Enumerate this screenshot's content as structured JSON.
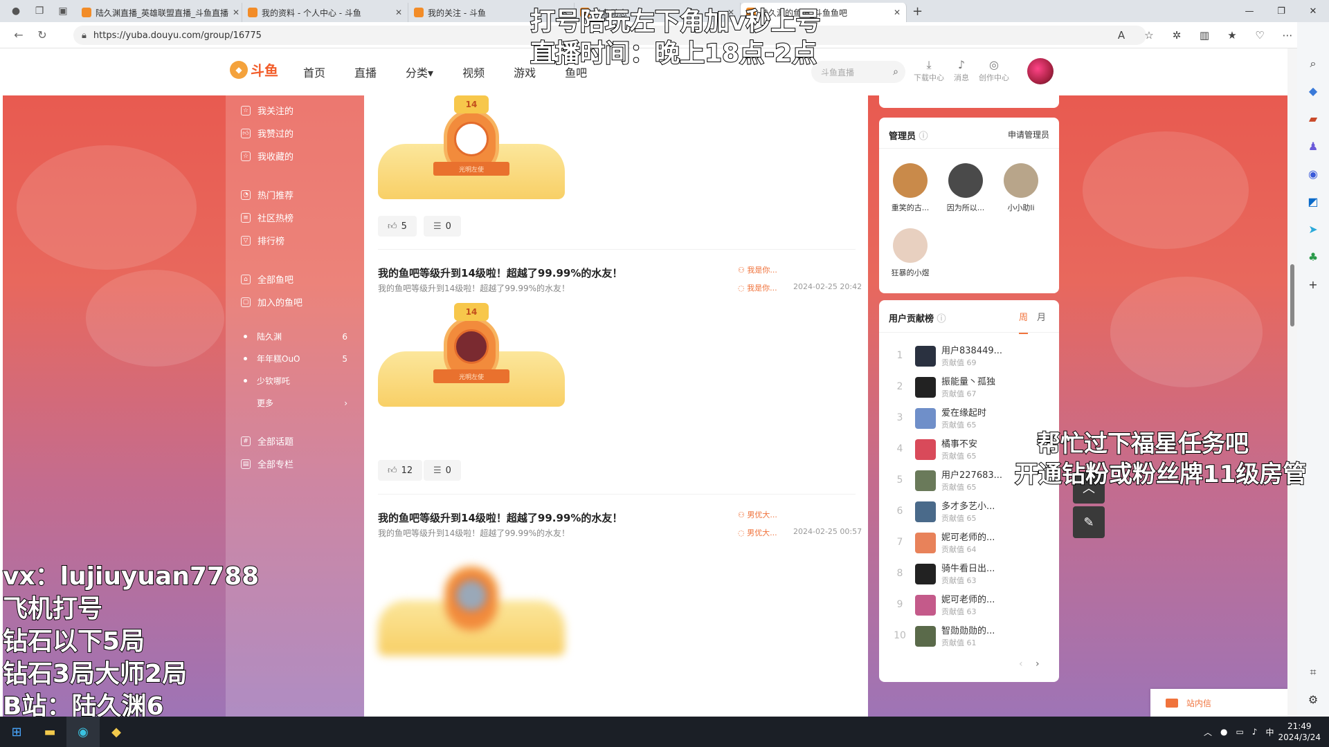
{
  "browser": {
    "tabs": [
      {
        "title": "陆久渊直播_英雄联盟直播_斗鱼直播"
      },
      {
        "title": "我的资料 - 个人中心 - 斗鱼"
      },
      {
        "title": "我的关注 - 斗鱼"
      },
      {
        "title": "斗鱼动态"
      },
      {
        "title": "陆久渊的鱼吧_斗鱼鱼吧"
      }
    ],
    "url": "https://yuba.douyu.com/group/16775"
  },
  "site": {
    "logo_text": "斗鱼",
    "nav": [
      "首页",
      "直播",
      "分类▾",
      "视频",
      "游戏",
      "鱼吧"
    ],
    "search_placeholder": "斗鱼直播",
    "header_icons": [
      {
        "icon": "download-icon",
        "label": "下载中心"
      },
      {
        "icon": "bell-icon",
        "label": "消息"
      },
      {
        "icon": "bulb-icon",
        "label": "创作中心"
      }
    ]
  },
  "sidebar": {
    "items": [
      {
        "icon": "star-icon",
        "label": "我关注的"
      },
      {
        "icon": "thumb-up-icon",
        "label": "我赞过的"
      },
      {
        "icon": "bookmark-icon",
        "label": "我收藏的"
      },
      {
        "icon": "fire-icon",
        "label": "热门推荐"
      },
      {
        "icon": "hot-list-icon",
        "label": "社区热榜"
      },
      {
        "icon": "trophy-icon",
        "label": "排行榜"
      },
      {
        "icon": "house-icon",
        "label": "全部鱼吧"
      },
      {
        "icon": "joined-icon",
        "label": "加入的鱼吧"
      }
    ],
    "groups": [
      {
        "name": "陆久渊",
        "count": "6"
      },
      {
        "name": "年年糕OuO",
        "count": "5"
      },
      {
        "name": "少钦哪吒",
        "count": ""
      }
    ],
    "more": "更多",
    "bottom": [
      {
        "icon": "hash-icon",
        "label": "全部话题"
      },
      {
        "icon": "column-icon",
        "label": "全部专栏"
      }
    ]
  },
  "feed": {
    "badge_number": "14",
    "badge_ribbon": "光明左使",
    "first_post": {
      "likes": "5",
      "comments": "0"
    },
    "posts": [
      {
        "title": "我的鱼吧等级升到14级啦！超越了99.99%的水友！",
        "subtitle": "我的鱼吧等级升到14级啦！超越了99.99%的水友！",
        "author": "我是你...",
        "author2": "我是你...",
        "date": "2024-02-25 20:42",
        "likes": "12",
        "comments": "0"
      },
      {
        "title": "我的鱼吧等级升到14级啦！超越了99.99%的水友！",
        "subtitle": "我的鱼吧等级升到14级啦！超越了99.99%的水友！",
        "author": "男优大...",
        "author2": "男优大...",
        "date": "2024-02-25 00:57"
      }
    ]
  },
  "admins": {
    "title": "管理员",
    "apply": "申请管理员",
    "list": [
      {
        "name": "重笑的古...",
        "color": "#c98a4a"
      },
      {
        "name": "因为所以...",
        "color": "#4a4a4a"
      },
      {
        "name": "小小助li",
        "color": "#b8a58a"
      },
      {
        "name": "狂暴的小煜",
        "color": "#e8d0c0"
      }
    ]
  },
  "contrib": {
    "title": "用户贡献榜",
    "tab_week": "周",
    "tab_month": "月",
    "score_label": "贡献值",
    "rows": [
      {
        "rank": "1",
        "name": "用户838449...",
        "score": "69",
        "color": "#2a3140"
      },
      {
        "rank": "2",
        "name": "振能量丶孤独",
        "score": "67",
        "color": "#222222"
      },
      {
        "rank": "3",
        "name": "爱在缘起时",
        "score": "65",
        "color": "#6f8fc9"
      },
      {
        "rank": "4",
        "name": "橘事不安",
        "score": "65",
        "color": "#d94a5a"
      },
      {
        "rank": "5",
        "name": "用户227683...",
        "score": "65",
        "color": "#6a7a5a"
      },
      {
        "rank": "6",
        "name": "多才多艺小...",
        "score": "65",
        "color": "#4a6a8a"
      },
      {
        "rank": "7",
        "name": "妮可老师的...",
        "score": "64",
        "color": "#e8825a"
      },
      {
        "rank": "8",
        "name": "骑牛看日出...",
        "score": "63",
        "color": "#222222"
      },
      {
        "rank": "9",
        "name": "妮可老师的...",
        "score": "63",
        "color": "#c45a8a"
      },
      {
        "rank": "10",
        "name": "智勋勋勋的...",
        "score": "61",
        "color": "#5a6a4a"
      }
    ]
  },
  "mail": {
    "label": "站内信"
  },
  "overlays": {
    "top_line1": "打号陪玩左下角加v秒上号",
    "top_line2": "直播时间：晚上18点-2点",
    "right_line1": "帮忙过下福星任务吧",
    "right_line2": "开通钻粉或粉丝牌11级房管",
    "left_lines": [
      "vx：lujiuyuan7788",
      "飞机打号",
      "钻石以下5局",
      "钻石3局大师2局",
      "B站：陆久渊6"
    ]
  },
  "taskbar": {
    "time": "21:49",
    "date": "2024/3/24",
    "ime": "中"
  }
}
